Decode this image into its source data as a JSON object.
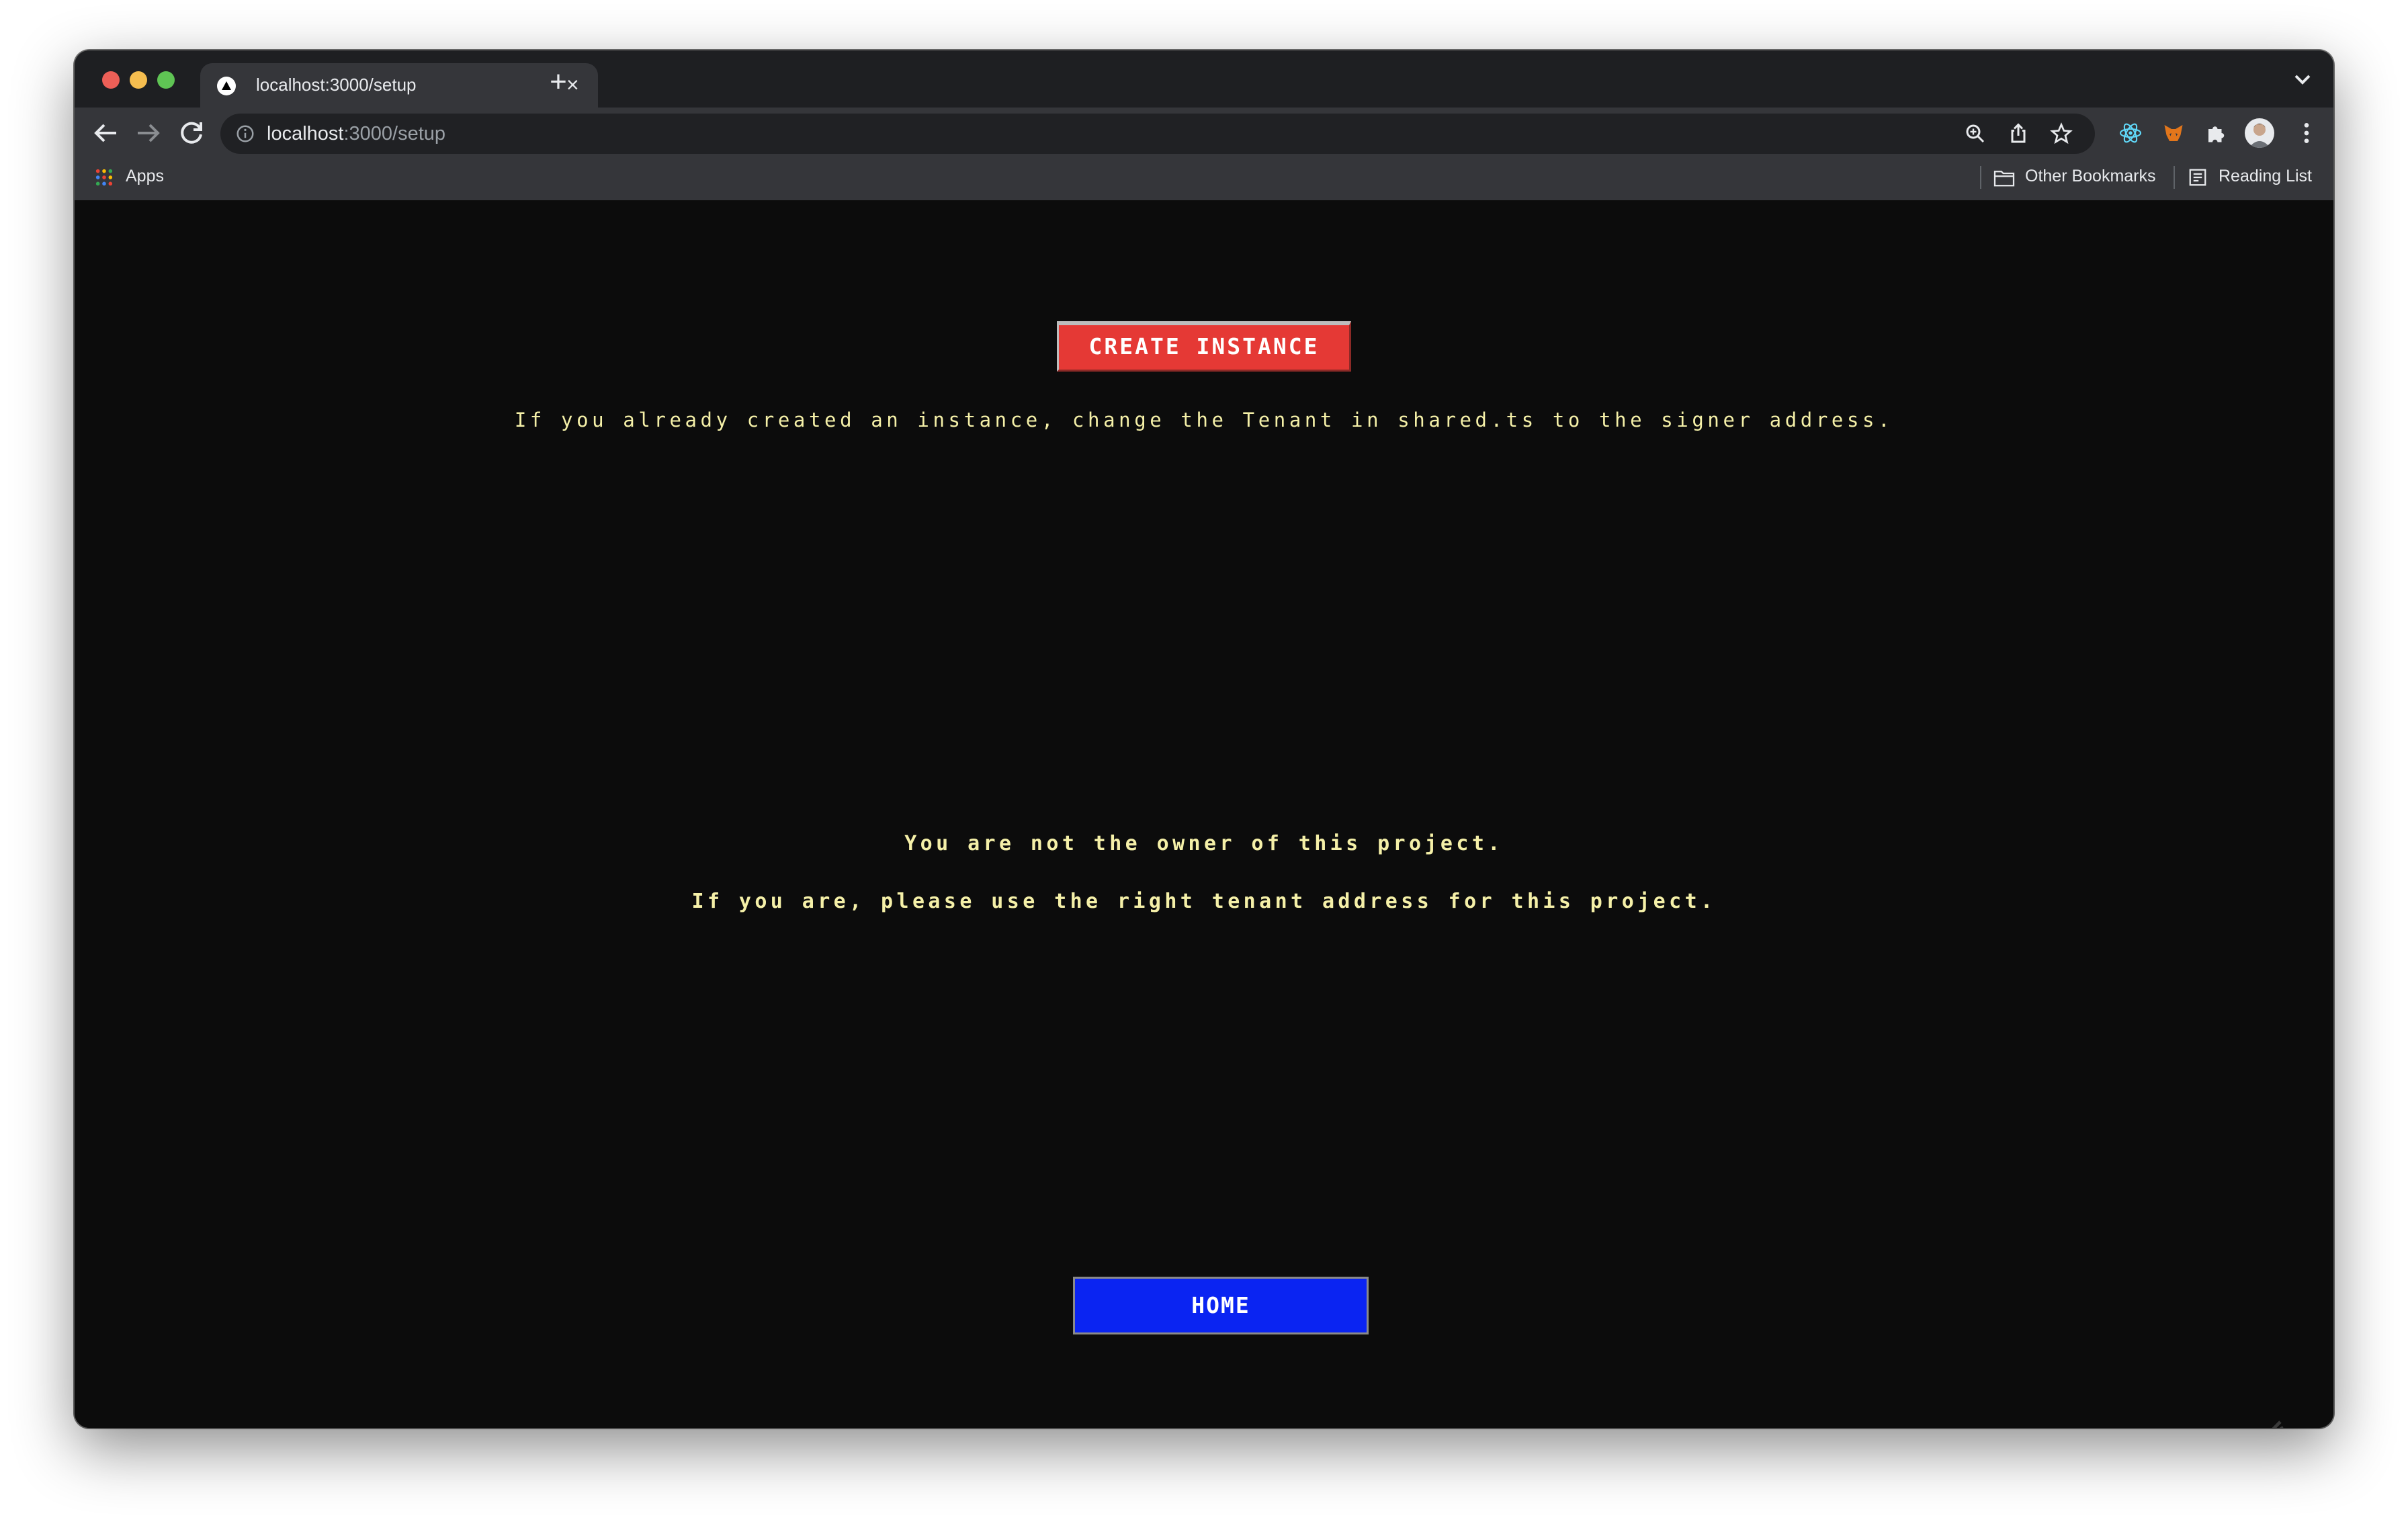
{
  "browser": {
    "tab": {
      "title": "localhost:3000/setup",
      "close_glyph": "×"
    },
    "new_tab_glyph": "+",
    "address_bar": {
      "host": "localhost",
      "path": ":3000/setup"
    },
    "icons": {
      "back": "arrow-left-icon",
      "forward": "arrow-right-icon",
      "reload": "reload-icon",
      "site_info": "info-icon",
      "zoom": "zoom-icon",
      "share": "share-icon",
      "bookmark": "star-icon",
      "react_devtools": "react-icon",
      "metamask": "fox-icon",
      "extensions": "puzzle-icon",
      "menu": "kebab-menu-icon"
    },
    "bookmarks": {
      "apps_label": "Apps",
      "other_label": "Other Bookmarks",
      "reading_label": "Reading List"
    }
  },
  "page": {
    "create_button_label": "CREATE INSTANCE",
    "instance_note": "If you already created an instance, change the Tenant in shared.ts to the signer address.",
    "owner_message": "You are not the owner of this project.",
    "tenant_message": "If you are, please use the right tenant address for this project.",
    "home_button_label": "HOME"
  },
  "colors": {
    "page_background": "#0c0c0c",
    "message_text": "#f5f0a8",
    "create_button": "#e53935",
    "home_button": "#0a24f2"
  }
}
